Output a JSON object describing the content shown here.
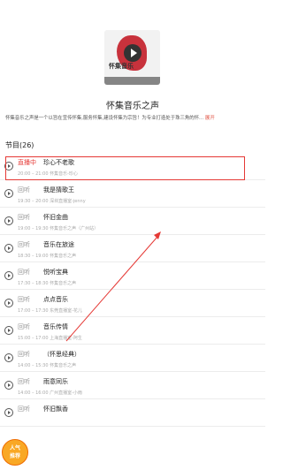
{
  "podcast": {
    "cover_title": "怀集音乐",
    "title": "怀集音乐之声",
    "description": "怀集音乐之声是一个以旨在宣传怀集,服务怀集,建设怀集为宗旨！为专业打造处于珠三角的怀...",
    "more_label": "展开"
  },
  "section": {
    "header": "节目(26)"
  },
  "items": [
    {
      "status": "直播中",
      "name": "珍心不老歌",
      "meta": "20:00 – 21:00   怀集音乐-珍心"
    },
    {
      "status": "回听",
      "name": "我是猜歌王",
      "meta": "19:30 – 20:00   深圳直播室-jenny"
    },
    {
      "status": "回听",
      "name": "怀旧金曲",
      "meta": "19:00 – 19:30   怀集音乐之声（广州站）"
    },
    {
      "status": "回听",
      "name": "音乐在旅途",
      "meta": "18:30 – 19:00   怀集音乐之声"
    },
    {
      "status": "回听",
      "name": "悦听宝典",
      "meta": "17:30 – 18:30   怀集音乐之声"
    },
    {
      "status": "回听",
      "name": "点点音乐",
      "meta": "17:00 – 17:30   东莞直播室-花儿"
    },
    {
      "status": "回听",
      "name": "音乐传情",
      "meta": "15:00 – 17:00   上海直播室-阿生"
    },
    {
      "status": "回听",
      "name": "（怀思经典）",
      "meta": "14:00 – 15:30   怀集音乐之声"
    },
    {
      "status": "回听",
      "name": "雨意同乐",
      "meta": "14:00 – 16:00   广州直播室-小雨"
    },
    {
      "status": "回听",
      "name": "怀旧飘香",
      "meta": ""
    }
  ],
  "badge": {
    "line1": "人气",
    "line2": "推荐"
  },
  "colors": {
    "live": "#e53935",
    "accent": "#e05040"
  }
}
